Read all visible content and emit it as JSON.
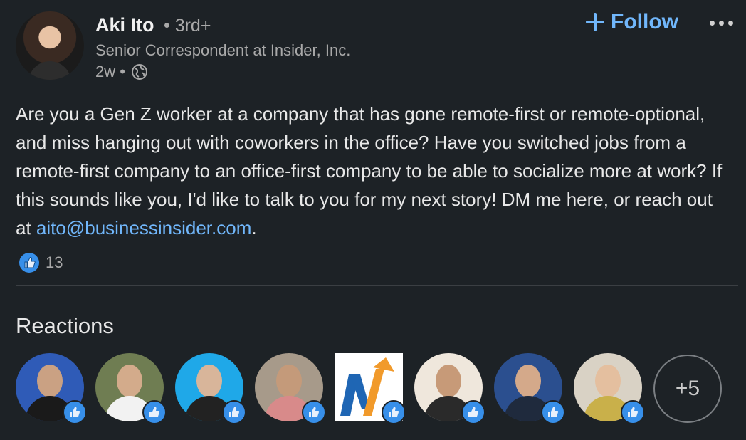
{
  "author": {
    "name": "Aki Ito",
    "degree": "• 3rd+",
    "headline": "Senior Correspondent at Insider, Inc.",
    "time": "2w •",
    "visibility_icon": "globe-icon"
  },
  "actions": {
    "follow_label": "Follow",
    "more_icon": "more-icon"
  },
  "post": {
    "text": "Are you a Gen Z worker at a company that has gone remote-first or remote-optional, and miss hanging out with coworkers in the office? Have you switched jobs from a remote-first company to an office-first company to be able to socialize more at work? If this sounds like you, I'd like to talk to you for my next story! DM me here, or reach out at ",
    "email": "aito@businessinsider.com",
    "end": "."
  },
  "social": {
    "reaction_count": "13",
    "reaction_icon": "like-icon"
  },
  "reactions": {
    "title": "Reactions",
    "more_count": "+5"
  },
  "colors": {
    "background": "#1d2226",
    "accent": "#71b7fb",
    "muted_text": "#a9a9a9"
  }
}
